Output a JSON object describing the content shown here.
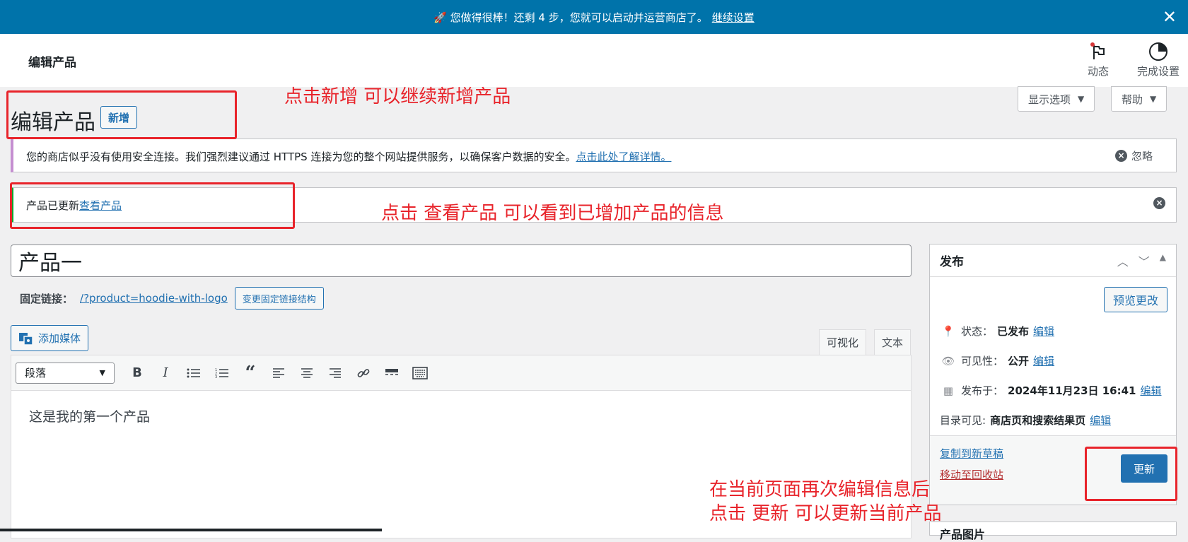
{
  "topbar": {
    "message": "🚀 您做得很棒！还剩 4 步，您就可以启动并运营商店了。",
    "link": "继续设置",
    "close": "✕"
  },
  "header": {
    "title": "编辑产品",
    "activity_label": "动态",
    "finish_label": "完成设置"
  },
  "tabs": {
    "screen_options": "显示选项",
    "help": "帮助",
    "caret": "▼"
  },
  "page": {
    "heading": "编辑产品",
    "add_new": "新增"
  },
  "notices": {
    "https": {
      "text": "您的商店似乎没有使用安全连接。我们强烈建议通过 HTTPS 连接为您的整个网站提供服务，以确保客户数据的安全。",
      "link": "点击此处了解详情。",
      "dismiss": "忽略"
    },
    "updated": {
      "text": "产品已更新",
      "link": "查看产品"
    }
  },
  "product": {
    "title": "产品一",
    "permalink_label": "固定链接：",
    "permalink_url": "/?product=hoodie-with-logo",
    "change_permalink": "变更固定链接结构",
    "add_media": "添加媒体"
  },
  "editor": {
    "tab_visual": "可视化",
    "tab_text": "文本",
    "format": "段落",
    "content": "这是我的第一个产品"
  },
  "publish": {
    "title": "发布",
    "preview": "预览更改",
    "status_label": "状态：",
    "status_value": "已发布",
    "visibility_label": "可见性：",
    "visibility_value": "公开",
    "published_label": "发布于：",
    "published_value": "2024年11月23日 16:41",
    "catalog_label": "目录可见:",
    "catalog_value": "商店页和搜索结果页",
    "edit": "编辑",
    "copy_draft": "复制到新草稿",
    "trash": "移动至回收站",
    "update": "更新"
  },
  "product_image_box": {
    "title": "产品图片"
  },
  "annotations": {
    "add_new": "点击新增 可以继续新增产品",
    "view_product": "点击 查看产品 可以看到已增加产品的信息",
    "update": "在当前页面再次编辑信息后\n点击 更新 可以更新当前产品"
  },
  "colors": {
    "topbar": "#0073aa",
    "primary": "#2271b1",
    "annotation": "#e8242b",
    "success": "#00a32a"
  }
}
